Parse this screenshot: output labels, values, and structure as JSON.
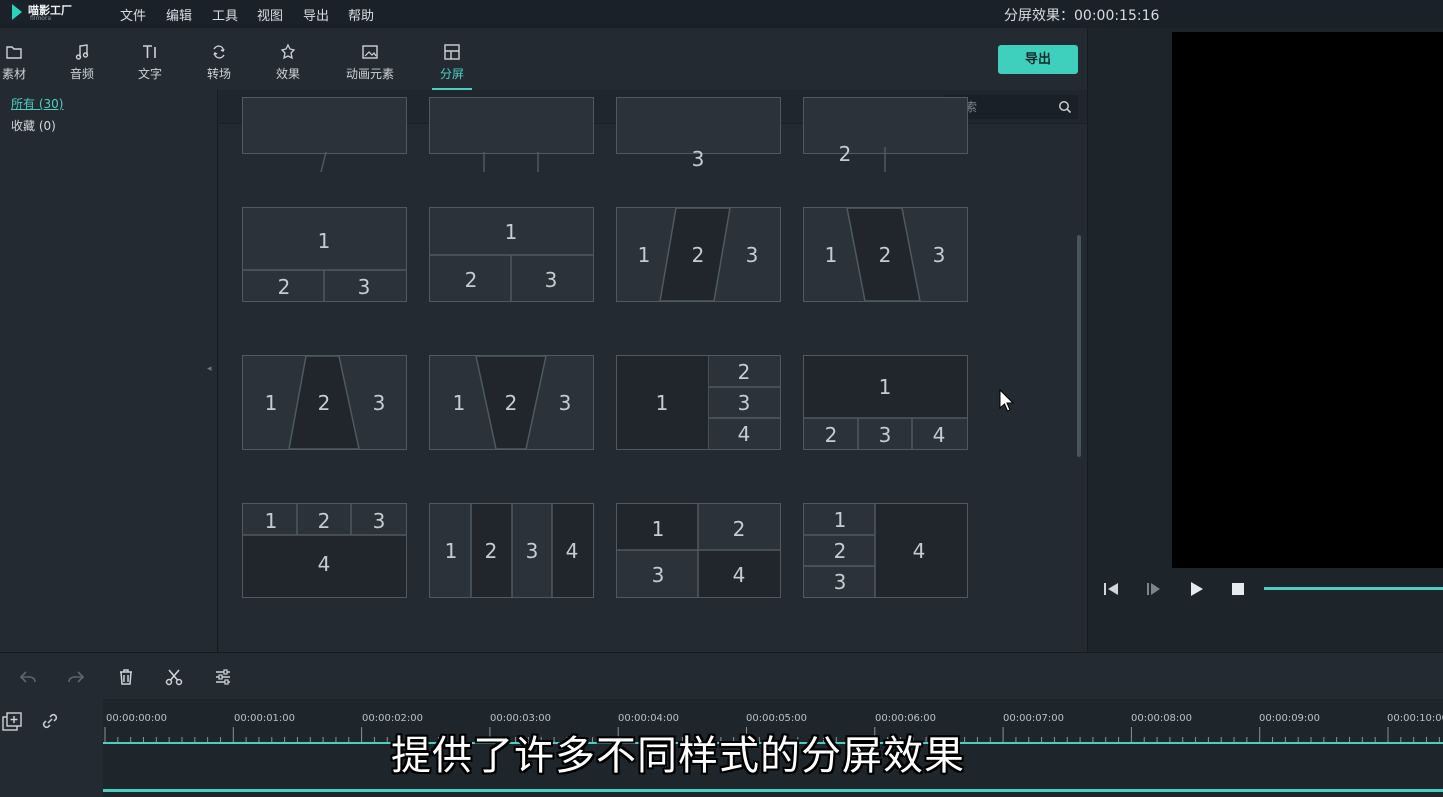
{
  "app": {
    "logo_text": "喵影工厂",
    "logo_sub": "filmora"
  },
  "menu": [
    "文件",
    "编辑",
    "工具",
    "视图",
    "导出",
    "帮助"
  ],
  "status": "分屏效果：00:00:15:16",
  "tools": [
    {
      "label": "素材",
      "icon": "folder-icon"
    },
    {
      "label": "音频",
      "icon": "music-note-icon"
    },
    {
      "label": "文字",
      "icon": "text-icon"
    },
    {
      "label": "转场",
      "icon": "transition-icon"
    },
    {
      "label": "效果",
      "icon": "effects-icon"
    },
    {
      "label": "动画元素",
      "icon": "image-element-icon"
    },
    {
      "label": "分屏",
      "icon": "split-screen-icon",
      "active": true
    }
  ],
  "export_label": "导出",
  "sidebar": {
    "items": [
      {
        "label": "所有 (30)",
        "selected": true
      },
      {
        "label": "收藏 (0)",
        "selected": false
      }
    ]
  },
  "search": {
    "placeholder": "搜索"
  },
  "tiles": {
    "row0": [
      "",
      "",
      "3",
      "2"
    ],
    "row1": [
      {
        "labels": [
          "1",
          "2",
          "3"
        ]
      },
      {
        "labels": [
          "1",
          "2",
          "3"
        ]
      },
      {
        "labels": [
          "1",
          "2",
          "3"
        ]
      },
      {
        "labels": [
          "1",
          "2",
          "3"
        ]
      }
    ],
    "row2": [
      {
        "labels": [
          "1",
          "2",
          "3"
        ]
      },
      {
        "labels": [
          "1",
          "2",
          "3"
        ]
      },
      {
        "labels": [
          "1",
          "2",
          "3",
          "4"
        ]
      },
      {
        "labels": [
          "1",
          "2",
          "3",
          "4"
        ]
      }
    ],
    "row3": [
      {
        "labels": [
          "1",
          "2",
          "3",
          "4"
        ]
      },
      {
        "labels": [
          "1",
          "2",
          "3",
          "4"
        ]
      },
      {
        "labels": [
          "1",
          "2",
          "3",
          "4"
        ]
      },
      {
        "labels": [
          "1",
          "2",
          "3",
          "4"
        ]
      }
    ]
  },
  "timeline": {
    "ticks": [
      "00:00:00:00",
      "00:00:01:00",
      "00:00:02:00",
      "00:00:03:00",
      "00:00:04:00",
      "00:00:05:00",
      "00:00:06:00",
      "00:00:07:00",
      "00:00:08:00",
      "00:00:09:00",
      "00:00:10:00"
    ]
  },
  "subtitle": "提供了许多不同样式的分屏效果",
  "colors": {
    "accent": "#3fd0bd",
    "background": "#232a31",
    "preview": "#000000"
  }
}
